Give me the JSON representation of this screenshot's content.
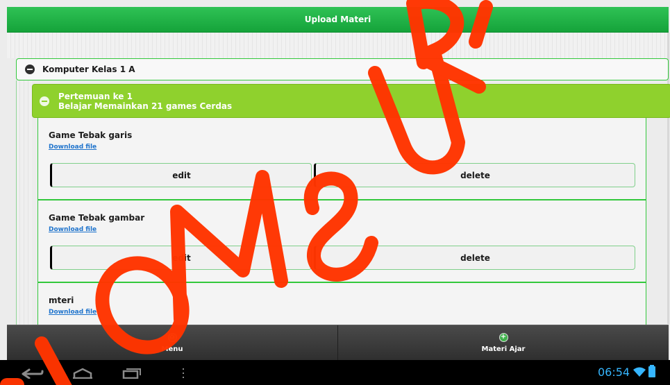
{
  "header": {
    "title": "Upload Materi"
  },
  "class_group": {
    "title": "Komputer Kelas 1 A"
  },
  "meeting": {
    "line1": "Pertemuan ke 1",
    "line2": "Belajar Memainkan 21 games Cerdas"
  },
  "materials": [
    {
      "title": "Game Tebak garis",
      "download": "Download file",
      "edit": "edit",
      "delete": "delete"
    },
    {
      "title": "Game Tebak gambar",
      "download": "Download file",
      "edit": "edit",
      "delete": "delete"
    },
    {
      "title": "mteri",
      "download": "Download file"
    }
  ],
  "bottom_nav": {
    "menu": "Menu",
    "materi_ajar": "Materi Ajar"
  },
  "status": {
    "time": "06:54"
  },
  "colors": {
    "header_green": "#15a33a",
    "accent_green": "#32c83c",
    "lime": "#8fd12d",
    "link_blue": "#1e73cc",
    "clock_blue": "#36b6ff"
  },
  "icons": {
    "collapse": "minus-circle-icon",
    "menu": "home-icon",
    "add": "plus-circle-icon",
    "system": [
      "back-icon",
      "home-icon",
      "recent-apps-icon",
      "overflow-dots-icon",
      "wifi-icon",
      "battery-icon"
    ]
  }
}
